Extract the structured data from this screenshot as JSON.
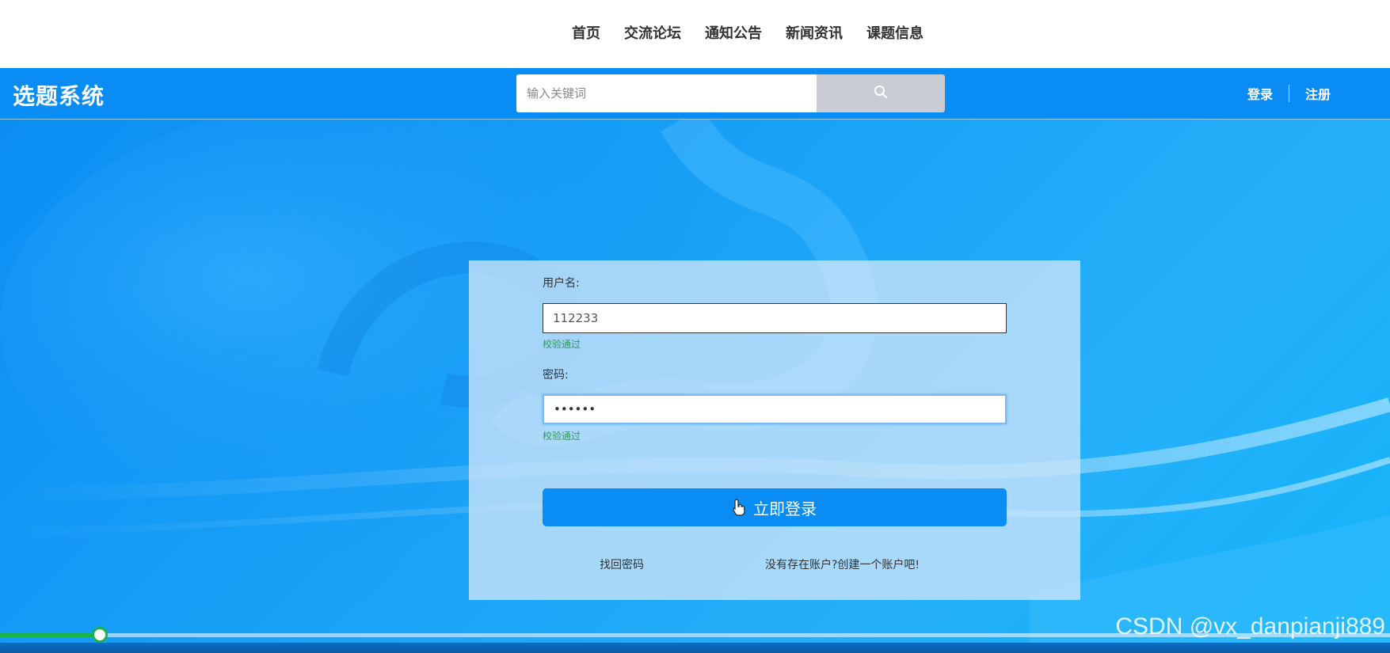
{
  "nav": {
    "items": [
      {
        "label": "首页"
      },
      {
        "label": "交流论坛"
      },
      {
        "label": "通知公告"
      },
      {
        "label": "新闻资讯"
      },
      {
        "label": "课题信息"
      }
    ]
  },
  "header": {
    "logo": "选题系统",
    "search_placeholder": "输入关键词",
    "search_icon": "search-icon",
    "login_label": "登录",
    "register_label": "注册"
  },
  "form": {
    "username_label": "用户名:",
    "username_value": "112233",
    "username_valid": "校验通过",
    "password_label": "密码:",
    "password_value": "••••••",
    "password_valid": "校验通过",
    "submit_label": "立即登录",
    "forgot_link": "找回密码",
    "register_link": "没有存在账户?创建一个账户吧!"
  },
  "video": {
    "progress": 0.072
  },
  "watermark": "CSDN @vx_danpianji889",
  "colors": {
    "primary": "#0a8cf5",
    "valid": "#2e9d4e",
    "progress": "#19b34a"
  }
}
